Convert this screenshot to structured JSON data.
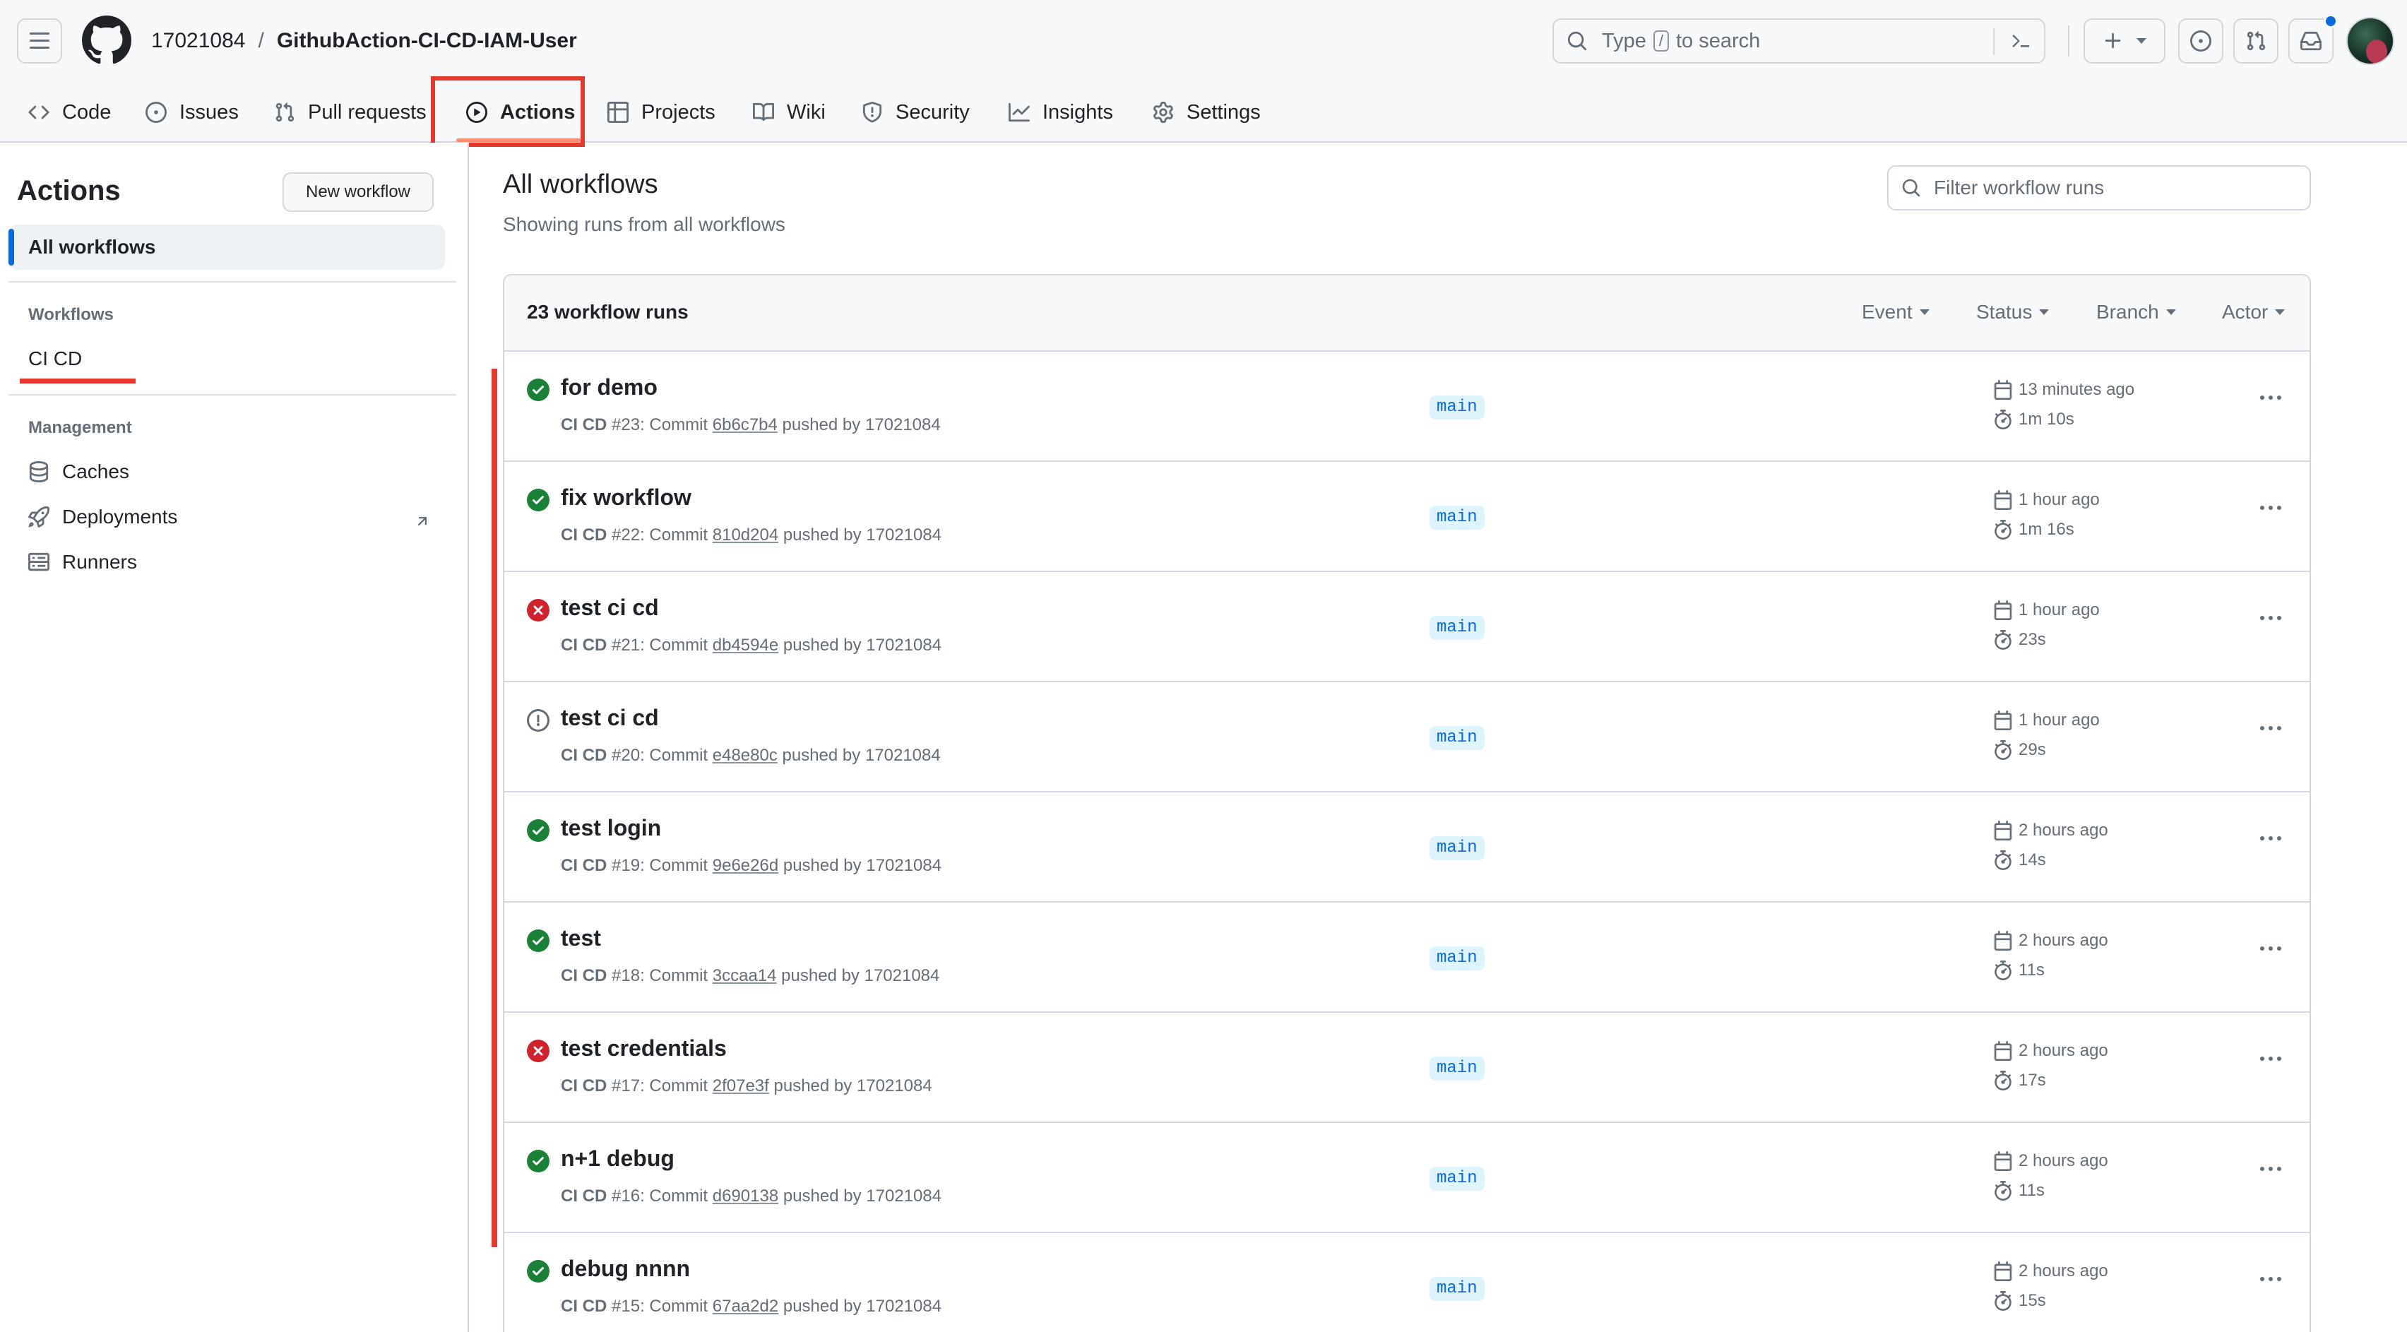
{
  "repo": {
    "owner": "17021084",
    "separator": "/",
    "name": "GithubAction-CI-CD-IAM-User"
  },
  "search": {
    "prefix": "Type",
    "key": "/",
    "suffix": "to search"
  },
  "nav": {
    "tabs": [
      {
        "label": "Code",
        "icon": "code-icon"
      },
      {
        "label": "Issues",
        "icon": "issue-opened-icon"
      },
      {
        "label": "Pull requests",
        "icon": "git-pull-request-icon"
      },
      {
        "label": "Actions",
        "icon": "play-icon",
        "selected": true
      },
      {
        "label": "Projects",
        "icon": "table-icon"
      },
      {
        "label": "Wiki",
        "icon": "book-icon"
      },
      {
        "label": "Security",
        "icon": "shield-icon"
      },
      {
        "label": "Insights",
        "icon": "graph-icon"
      },
      {
        "label": "Settings",
        "icon": "gear-icon"
      }
    ]
  },
  "sidebar": {
    "title": "Actions",
    "new_workflow": "New workflow",
    "all_workflows": "All workflows",
    "workflows_heading": "Workflows",
    "workflows": [
      "CI CD"
    ],
    "management_heading": "Management",
    "management": [
      {
        "label": "Caches",
        "icon": "database-icon"
      },
      {
        "label": "Deployments",
        "icon": "rocket-icon"
      },
      {
        "label": "Runners",
        "icon": "server-icon"
      }
    ]
  },
  "main": {
    "title": "All workflows",
    "subtitle": "Showing runs from all workflows",
    "filter_placeholder": "Filter workflow runs",
    "runs_count": "23 workflow runs",
    "filters": [
      "Event",
      "Status",
      "Branch",
      "Actor"
    ]
  },
  "runs": [
    {
      "title": "for demo",
      "workflow": "CI CD",
      "number": "#23",
      "commit_label": "Commit",
      "sha": "6b6c7b4",
      "pushed_by": "pushed by 17021084",
      "branch": "main",
      "time": "13 minutes ago",
      "duration": "1m 10s",
      "status": "success"
    },
    {
      "title": "fix workflow",
      "workflow": "CI CD",
      "number": "#22",
      "commit_label": "Commit",
      "sha": "810d204",
      "pushed_by": "pushed by 17021084",
      "branch": "main",
      "time": "1 hour ago",
      "duration": "1m 16s",
      "status": "success"
    },
    {
      "title": "test ci cd",
      "workflow": "CI CD",
      "number": "#21",
      "commit_label": "Commit",
      "sha": "db4594e",
      "pushed_by": "pushed by 17021084",
      "branch": "main",
      "time": "1 hour ago",
      "duration": "23s",
      "status": "failure"
    },
    {
      "title": "test ci cd",
      "workflow": "CI CD",
      "number": "#20",
      "commit_label": "Commit",
      "sha": "e48e80c",
      "pushed_by": "pushed by 17021084",
      "branch": "main",
      "time": "1 hour ago",
      "duration": "29s",
      "status": "startup_failure"
    },
    {
      "title": "test login",
      "workflow": "CI CD",
      "number": "#19",
      "commit_label": "Commit",
      "sha": "9e6e26d",
      "pushed_by": "pushed by 17021084",
      "branch": "main",
      "time": "2 hours ago",
      "duration": "14s",
      "status": "success"
    },
    {
      "title": "test",
      "workflow": "CI CD",
      "number": "#18",
      "commit_label": "Commit",
      "sha": "3ccaa14",
      "pushed_by": "pushed by 17021084",
      "branch": "main",
      "time": "2 hours ago",
      "duration": "11s",
      "status": "success"
    },
    {
      "title": "test credentials",
      "workflow": "CI CD",
      "number": "#17",
      "commit_label": "Commit",
      "sha": "2f07e3f",
      "pushed_by": "pushed by 17021084",
      "branch": "main",
      "time": "2 hours ago",
      "duration": "17s",
      "status": "failure"
    },
    {
      "title": "n+1 debug",
      "workflow": "CI CD",
      "number": "#16",
      "commit_label": "Commit",
      "sha": "d690138",
      "pushed_by": "pushed by 17021084",
      "branch": "main",
      "time": "2 hours ago",
      "duration": "11s",
      "status": "success"
    },
    {
      "title": "debug nnnn",
      "workflow": "CI CD",
      "number": "#15",
      "commit_label": "Commit",
      "sha": "67aa2d2",
      "pushed_by": "pushed by 17021084",
      "branch": "main",
      "time": "2 hours ago",
      "duration": "15s",
      "status": "success"
    }
  ],
  "colors": {
    "success": "#1a7f37",
    "failure": "#cf222e",
    "neutral": "#656d76",
    "accent": "#0969da",
    "annotation_red": "#e5392d",
    "tab_underline": "#fd8c73"
  }
}
